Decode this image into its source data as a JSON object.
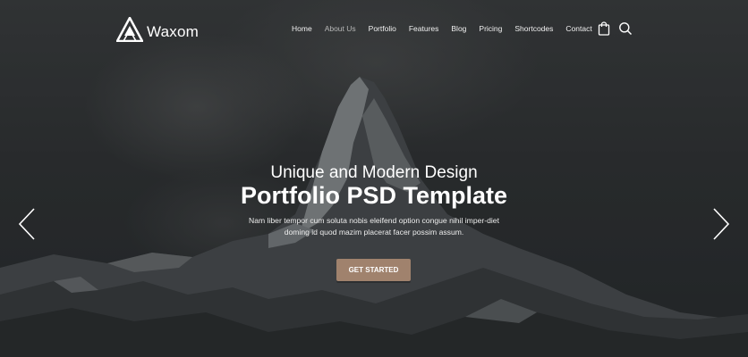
{
  "brand": {
    "name": "Waxom",
    "logo_icon": "triangle-logo-icon"
  },
  "nav": {
    "items": [
      {
        "label": "Home"
      },
      {
        "label": "About Us",
        "active": true
      },
      {
        "label": "Portfolio"
      },
      {
        "label": "Features"
      },
      {
        "label": "Blog"
      },
      {
        "label": "Pricing"
      },
      {
        "label": "Shortcodes"
      },
      {
        "label": "Contact"
      }
    ],
    "cart_icon": "shopping-bag-icon",
    "search_icon": "search-icon"
  },
  "hero": {
    "subtitle": "Unique and Modern Design",
    "title": "Portfolio PSD Template",
    "description": "Nam liber tempor cum soluta nobis eleifend option congue nihil imper-diet doming id quod mazim placerat facer possim assum.",
    "cta_label": "GET STARTED",
    "prev_icon": "chevron-left-icon",
    "next_icon": "chevron-right-icon"
  },
  "colors": {
    "accent": "#a0826d",
    "nav_active": "#b7b7b7",
    "text": "#ffffff"
  }
}
